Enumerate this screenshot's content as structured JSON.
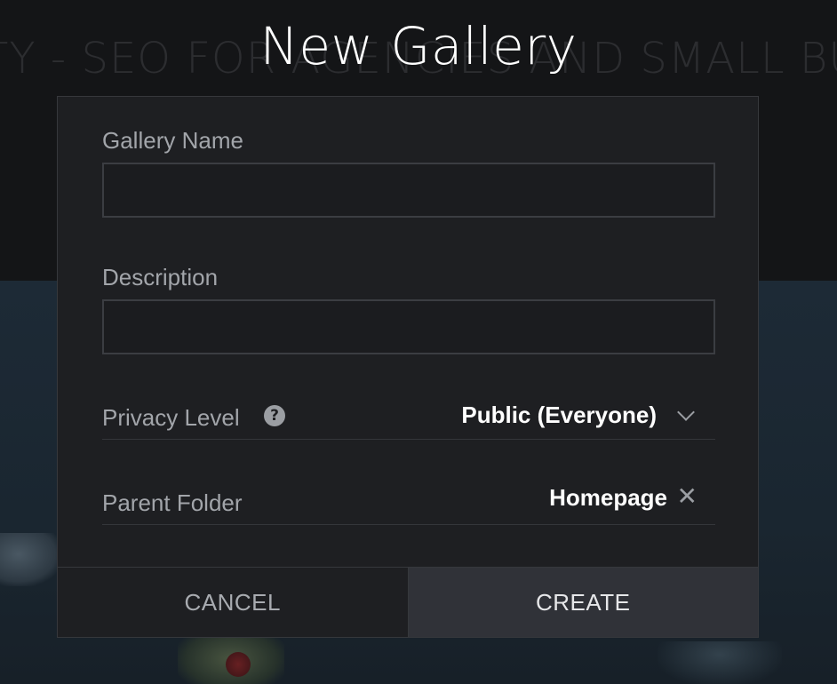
{
  "background": {
    "banner_text": "TY - SEO FOR AGENCIES AND SMALL BUSINESSES"
  },
  "dialog": {
    "title": "New Gallery",
    "gallery_name": {
      "label": "Gallery Name",
      "value": "",
      "placeholder": ""
    },
    "description": {
      "label": "Description",
      "value": "",
      "placeholder": ""
    },
    "privacy": {
      "label": "Privacy Level",
      "help_icon": "help-icon",
      "selected": "Public (Everyone)",
      "dropdown_icon": "chevron-down-icon"
    },
    "parent_folder": {
      "label": "Parent Folder",
      "value": "Homepage",
      "clear_icon": "close-icon"
    },
    "buttons": {
      "cancel": "CANCEL",
      "create": "CREATE"
    }
  },
  "colors": {
    "modal_bg": "#1e1f22",
    "create_button_bg": "#303238",
    "label": "#a2a5aa",
    "value": "#ffffff"
  }
}
